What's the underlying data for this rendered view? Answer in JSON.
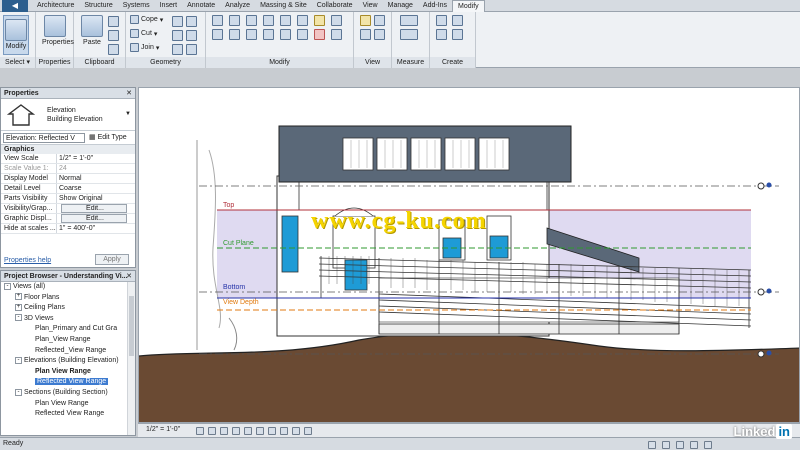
{
  "tabs": [
    "Architecture",
    "Structure",
    "Systems",
    "Insert",
    "Annotate",
    "Analyze",
    "Massing & Site",
    "Collaborate",
    "View",
    "Manage",
    "Add-Ins",
    "Modify"
  ],
  "active_tab": "Modify",
  "ribbon": {
    "modify_label": "Modify",
    "properties_label": "Properties",
    "paste_label": "Paste",
    "cope_label": "Cope",
    "cut_label": "Cut",
    "join_label": "Join",
    "panels": {
      "select": "Select",
      "properties": "Properties",
      "clipboard": "Clipboard",
      "geometry": "Geometry",
      "modify": "Modify",
      "view": "View",
      "measure": "Measure",
      "create": "Create"
    }
  },
  "properties": {
    "title": "Properties",
    "type_line1": "Elevation",
    "type_line2": "Building Elevation",
    "filter": "Elevation: Reflected V",
    "edit_type": "Edit Type",
    "section": "Graphics",
    "rows": [
      {
        "k": "View Scale",
        "v": "1/2\" = 1'-0\""
      },
      {
        "k": "Scale Value   1:",
        "v": "24"
      },
      {
        "k": "Display Model",
        "v": "Normal"
      },
      {
        "k": "Detail Level",
        "v": "Coarse"
      },
      {
        "k": "Parts Visibility",
        "v": "Show Original"
      },
      {
        "k": "Visibility/Grap...",
        "v": "Edit..."
      },
      {
        "k": "Graphic Displ...",
        "v": "Edit..."
      },
      {
        "k": "Hide at scales ...",
        "v": "1\" = 400'-0\""
      }
    ],
    "help": "Properties help",
    "apply": "Apply"
  },
  "browser": {
    "title": "Project Browser - Understanding Vi...",
    "items": [
      {
        "label": "Views (all)",
        "level": 0,
        "toggle": "-"
      },
      {
        "label": "Floor Plans",
        "level": 1,
        "toggle": "+"
      },
      {
        "label": "Ceiling Plans",
        "level": 1,
        "toggle": "+"
      },
      {
        "label": "3D Views",
        "level": 1,
        "toggle": "-"
      },
      {
        "label": "Plan_Primary and Cut Gra",
        "level": 2,
        "toggle": ""
      },
      {
        "label": "Plan_View Range",
        "level": 2,
        "toggle": ""
      },
      {
        "label": "Reflected_View Range",
        "level": 2,
        "toggle": ""
      },
      {
        "label": "Elevations (Building Elevation)",
        "level": 1,
        "toggle": "-"
      },
      {
        "label": "Plan View Range",
        "level": 2,
        "toggle": "",
        "bold": true
      },
      {
        "label": "Reflected View Range",
        "level": 2,
        "toggle": "",
        "selected": true
      },
      {
        "label": "Sections (Building Section)",
        "level": 1,
        "toggle": "-"
      },
      {
        "label": "Plan View Range",
        "level": 2,
        "toggle": ""
      },
      {
        "label": "Reflected View Range",
        "level": 2,
        "toggle": ""
      }
    ]
  },
  "view": {
    "levels": {
      "top": "Top",
      "cut_plane": "Cut Plane",
      "bottom": "Bottom",
      "view_depth": "View Depth"
    },
    "watermark": "www.cg-ku.com"
  },
  "vcb": {
    "scale": "1/2\" = 1'-0\""
  },
  "status": {
    "text": "Ready",
    "brand": "Linked",
    "brand_in": "in"
  },
  "colors": {
    "accent": "#2d5f8e",
    "selection": "#3d7bd0",
    "level_top": "#b0303a",
    "level_cut": "#2f9a2f",
    "level_bottom": "#2432a8",
    "level_depth": "#e07a10",
    "range_fill": "#d9d4ee"
  }
}
